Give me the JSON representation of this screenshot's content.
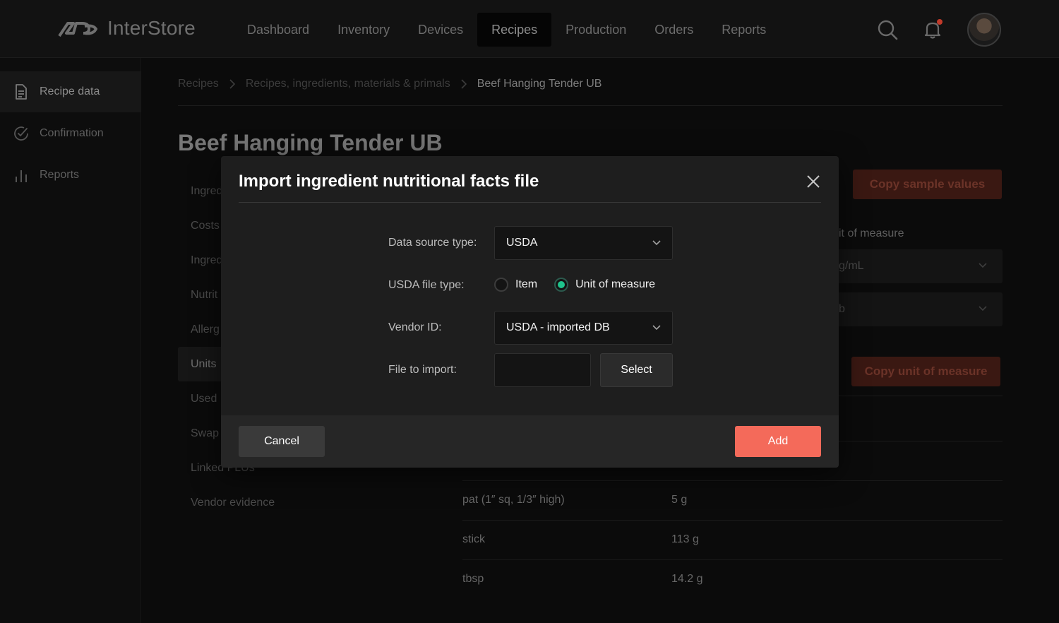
{
  "app": {
    "brand_name": "InterStore",
    "nav": [
      "Dashboard",
      "Inventory",
      "Devices",
      "Recipes",
      "Production",
      "Orders",
      "Reports"
    ],
    "active_nav": "Recipes"
  },
  "sidebar": {
    "items": [
      {
        "label": "Recipe data",
        "icon": "document-icon"
      },
      {
        "label": "Confirmation",
        "icon": "check-circle-icon"
      },
      {
        "label": "Reports",
        "icon": "bar-chart-icon"
      }
    ]
  },
  "breadcrumb": [
    "Recipes",
    "Recipes, ingredients, materials & primals",
    "Beef Hanging Tender UB"
  ],
  "page": {
    "title": "Beef Hanging Tender UB",
    "subnav": [
      "Ingred",
      "Costs",
      "Ingred",
      "Nutrit",
      "Allerg",
      "Units",
      "Used",
      "Swap",
      "Linked PLUs",
      "Vendor evidence"
    ],
    "copy_sample_values_label": "Copy sample values",
    "copy_unit_of_measure_label": "Copy unit of measure",
    "unit_of_measure_label": "it of measure",
    "select_1_value": "g/mL",
    "select_2_value": "b",
    "rows": [
      {
        "unit": "pat (1″ sq, 1/3″ high)",
        "value": "5 g"
      },
      {
        "unit": "stick",
        "value": "113 g"
      },
      {
        "unit": "tbsp",
        "value": "14.2 g"
      }
    ]
  },
  "modal": {
    "title": "Import ingredient nutritional facts file",
    "data_source_label": "Data source type:",
    "data_source_value": "USDA",
    "file_type_label": "USDA file type:",
    "file_type_options": [
      "Item",
      "Unit of measure"
    ],
    "file_type_selected": "Unit of measure",
    "vendor_label": "Vendor ID:",
    "vendor_value": "USDA - imported DB",
    "file_label": "File to import:",
    "file_value": "",
    "select_label": "Select",
    "cancel_label": "Cancel",
    "add_label": "Add"
  },
  "colors": {
    "accent": "#f46a5a",
    "radio_selected": "#1ec48c",
    "modal_bg": "#1e1e1e",
    "page_bg": "#0b0b0b"
  }
}
